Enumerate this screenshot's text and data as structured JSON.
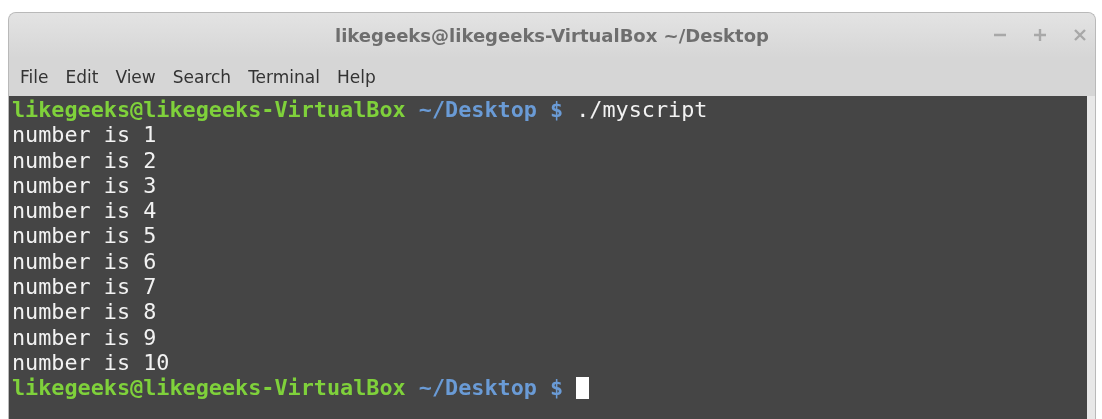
{
  "window": {
    "title": "likegeeks@likegeeks-VirtualBox ~/Desktop"
  },
  "menu": [
    "File",
    "Edit",
    "View",
    "Search",
    "Terminal",
    "Help"
  ],
  "terminal": {
    "lines": [
      {
        "kind": "prompt",
        "user_host": "likegeeks@likegeeks-VirtualBox",
        "path": "~/Desktop",
        "symbol": "$",
        "command": "./myscript",
        "cursor": false
      },
      {
        "kind": "output",
        "text": "number is 1"
      },
      {
        "kind": "output",
        "text": "number is 2"
      },
      {
        "kind": "output",
        "text": "number is 3"
      },
      {
        "kind": "output",
        "text": "number is 4"
      },
      {
        "kind": "output",
        "text": "number is 5"
      },
      {
        "kind": "output",
        "text": "number is 6"
      },
      {
        "kind": "output",
        "text": "number is 7"
      },
      {
        "kind": "output",
        "text": "number is 8"
      },
      {
        "kind": "output",
        "text": "number is 9"
      },
      {
        "kind": "output",
        "text": "number is 10"
      },
      {
        "kind": "prompt",
        "user_host": "likegeeks@likegeeks-VirtualBox",
        "path": "~/Desktop",
        "symbol": "$",
        "cursor": true
      }
    ]
  }
}
